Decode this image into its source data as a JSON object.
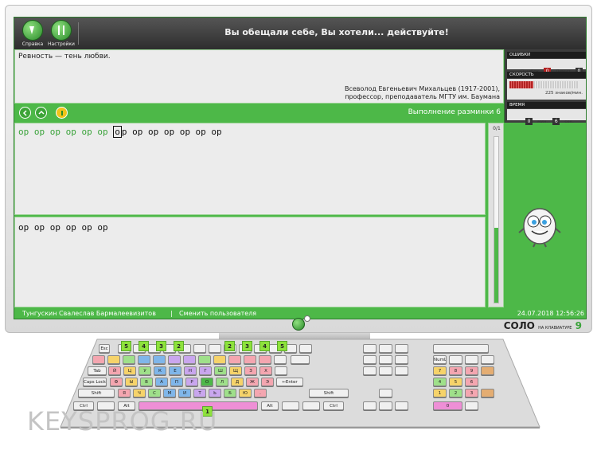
{
  "topbar": {
    "buttons": [
      {
        "label": "Справка",
        "icon": "help-icon"
      },
      {
        "label": "Настройки",
        "icon": "settings-icon"
      }
    ],
    "motto": "Вы обещали себе, Вы хотели... действуйте!"
  },
  "quote": {
    "text": "Ревность — тень любви.",
    "author_line1": "Всеволод Евгеньевич Михальцев (1917-2001),",
    "author_line2": "профессор, преподаватель МГТУ им. Баумана"
  },
  "stats": {
    "errors_title": "ОШИБКИ",
    "errors_label": "Ошибок",
    "errors_value": "0",
    "limit_label": "Лимит",
    "limit_value": "0",
    "speed_title": "СКОРОСТЬ",
    "speed_text": "225 знаков/мин.",
    "speed_level": 0.35,
    "time_title": "ВРЕМЯ",
    "time_min": "0",
    "time_min_label": "мин.",
    "time_sec": "6",
    "time_sec_label": "сек."
  },
  "toolbar": {
    "progress_label": "Выполнение разминки 6"
  },
  "exercise": {
    "done": "ор ор ор ор ор ор ",
    "current": "о",
    "remaining": "р ор ор ор ор ор ор",
    "typed": "ор ор ор ор ор ор"
  },
  "progress": {
    "count": "0/1",
    "level": 0.45
  },
  "status": {
    "user": "Тунгускин Свалеслав Бармалеевизитов",
    "separator": "|",
    "change_user": "Сменить пользователя",
    "datetime": "24.07.2018 12:56:26"
  },
  "brand": {
    "solo": "СОЛО",
    "sub": "НА КЛАВИАТУРЕ",
    "nine": "9"
  },
  "keyboard": {
    "fingers": [
      "5",
      "4",
      "3",
      "2",
      "2",
      "3",
      "4",
      "5",
      "1"
    ],
    "keys": {
      "esc": "Esc",
      "tab": "Tab",
      "caps": "Caps Lock",
      "shift_l": "Shift",
      "shift_r": "Shift",
      "enter": "Enter",
      "alt_l": "Alt",
      "alt_r": "Alt",
      "ctrl": "Ctrl",
      "numlock": "NumLock",
      "row1": [
        "Й",
        "Ц",
        "У",
        "К",
        "Е",
        "Н",
        "Г",
        "Ш",
        "Щ",
        "З",
        "Х"
      ],
      "row2": [
        "Ф",
        "Ы",
        "В",
        "А",
        "П",
        "Р",
        "О",
        "Л",
        "Д",
        "Ж",
        "Э"
      ],
      "row3": [
        "Я",
        "Ч",
        "С",
        "М",
        "И",
        "Т",
        "Ь",
        "Б",
        "Ю",
        "."
      ],
      "numpad": [
        "7",
        "8",
        "9",
        "4",
        "5",
        "6",
        "1",
        "2",
        "3",
        "0"
      ]
    }
  },
  "watermark": "KEYSPROG.RU",
  "colors": {
    "accent": "#4db848",
    "done_text": "#3aa33a",
    "finger_badge": "#8ee23c"
  }
}
